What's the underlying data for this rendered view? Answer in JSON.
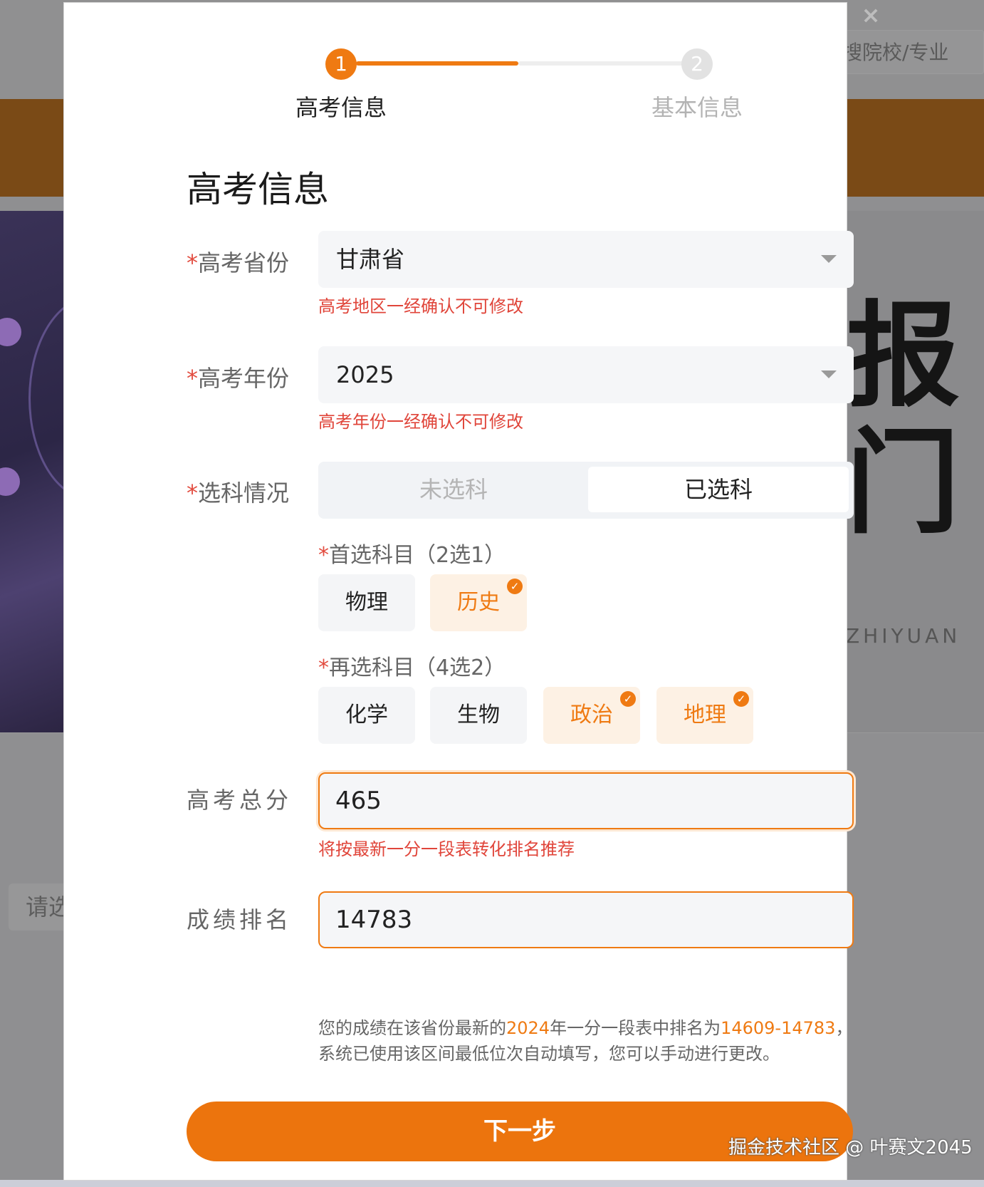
{
  "background": {
    "search_placeholder": "搜院校/专业",
    "banner_big_1": "报",
    "banner_big_2": "门",
    "banner_small": "ZHIYUAN",
    "left_input_placeholder": "请选"
  },
  "modal": {
    "close_glyph": "×",
    "steps": [
      {
        "number": "1",
        "label": "高考信息",
        "state": "active"
      },
      {
        "number": "2",
        "label": "基本信息",
        "state": "inactive"
      }
    ],
    "section_title": "高考信息",
    "province": {
      "required_mark": "*",
      "label": "高考省份",
      "value": "甘肃省",
      "hint": "高考地区一经确认不可修改"
    },
    "year": {
      "required_mark": "*",
      "label": "高考年份",
      "value": "2025",
      "hint": "高考年份一经确认不可修改"
    },
    "subject_status": {
      "required_mark": "*",
      "label": "选科情况",
      "options": [
        "未选科",
        "已选科"
      ],
      "selected": "已选科"
    },
    "first_subject": {
      "required_mark": "*",
      "label": "首选科目（2选1）",
      "options": [
        {
          "label": "物理",
          "selected": false
        },
        {
          "label": "历史",
          "selected": true
        }
      ]
    },
    "second_subject": {
      "required_mark": "*",
      "label": "再选科目（4选2）",
      "options": [
        {
          "label": "化学",
          "selected": false
        },
        {
          "label": "生物",
          "selected": false
        },
        {
          "label": "政治",
          "selected": true
        },
        {
          "label": "地理",
          "selected": true
        }
      ]
    },
    "total_score": {
      "label": "高考总分",
      "value": "465",
      "hint": "将按最新一分一段表转化排名推荐"
    },
    "rank": {
      "label": "成绩排名",
      "value": "14783",
      "info_part1": "您的成绩在该省份最新的",
      "info_year": "2024",
      "info_part2": "年一分一段表中排名为",
      "info_range": "14609-14783",
      "info_part3": "，",
      "info_line2": "系统已使用该区间最低位次自动填写，您可以手动进行更改。"
    },
    "next_button": "下一步"
  },
  "watermark": "掘金技术社区 @ 叶赛文2045",
  "colors": {
    "accent": "#ef7a12",
    "error": "#e0453a",
    "selected_chip_bg": "#fdf1e4"
  }
}
